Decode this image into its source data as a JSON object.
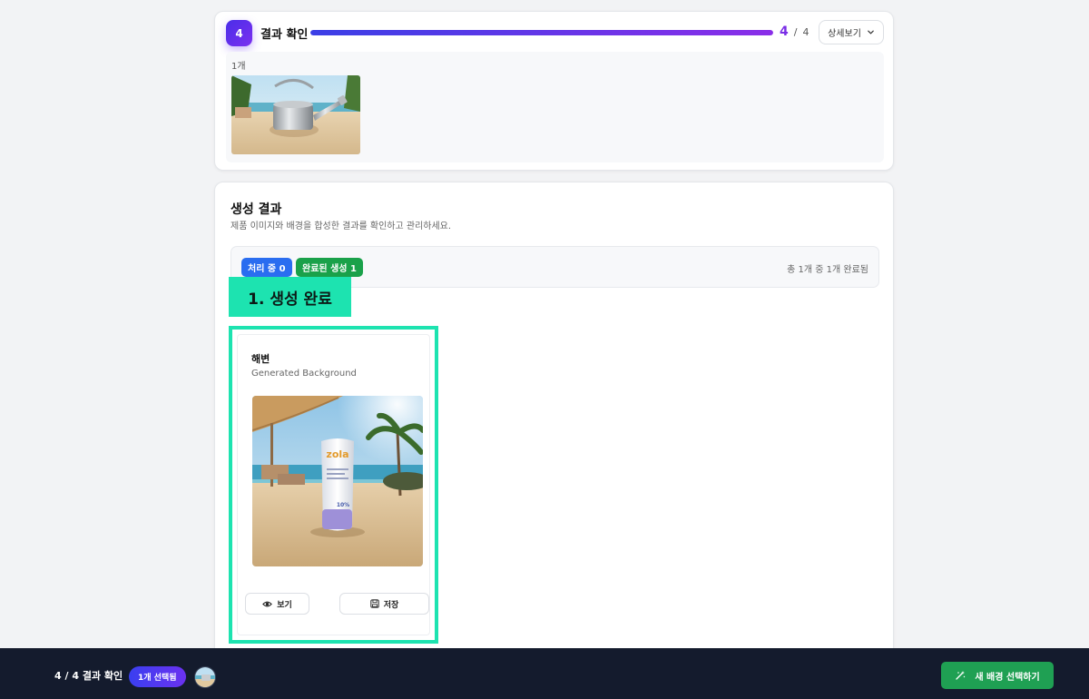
{
  "step": {
    "number": "4",
    "title": "결과 확인",
    "progress_fraction": 1.0,
    "current": "4",
    "separator": "/",
    "total": "4",
    "detail_button_label": "상세보기",
    "selected_count_label": "1개",
    "thumbnail_icon": "watering-can-beach-image"
  },
  "results": {
    "title": "생성 결과",
    "subtitle": "제품 이미지와 배경을 합성한 결과를 확인하고 관리하세요.",
    "processing_pill": "처리 중 0",
    "completed_pill": "완료된 생성 1",
    "summary": "총 1개 중 1개 완료됨"
  },
  "annotation": {
    "label": "1. 생성 완료",
    "color": "#1de3b0"
  },
  "result_card": {
    "title": "해변",
    "subtitle": "Generated Background",
    "image_icon": "sunscreen-on-beach-image",
    "product_brand": "zola",
    "product_spf": "10%",
    "view_label": "보기",
    "save_label": "저장"
  },
  "bottom_bar": {
    "status": "4 / 4 결과 확인",
    "selected_pill": "1개 선택됨",
    "cta_label": "새 배경 선택하기"
  },
  "colors": {
    "accent_purple": "#7a2ee6",
    "accent_blue": "#2a6df0",
    "success_green": "#1aa14a",
    "cta_green": "#1fa053",
    "bottom_bar_bg": "#141b2d"
  }
}
